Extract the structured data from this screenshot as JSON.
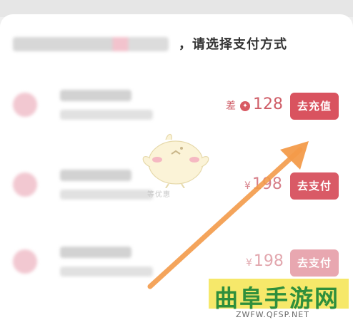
{
  "header": {
    "title": "，请选择支付方式"
  },
  "options": [
    {
      "price_prefix": "差",
      "coin_icon": "coin-icon",
      "price": "128",
      "button_label": "去充值"
    },
    {
      "currency": "¥",
      "price": "198",
      "button_label": "去支付"
    },
    {
      "currency": "¥",
      "price": "198",
      "button_label": "去支付"
    }
  ],
  "mascot": {
    "icon": "chick-mascot-icon",
    "caption": "等优惠"
  },
  "watermark": {
    "title": "曲阜手游网",
    "url": "ZWFW.QFSP.NET"
  },
  "colors": {
    "accent": "#d9535f",
    "arrow": "#f39b4a",
    "watermark_bg": "#f6e86a",
    "watermark_text": "#2f8f3c"
  }
}
